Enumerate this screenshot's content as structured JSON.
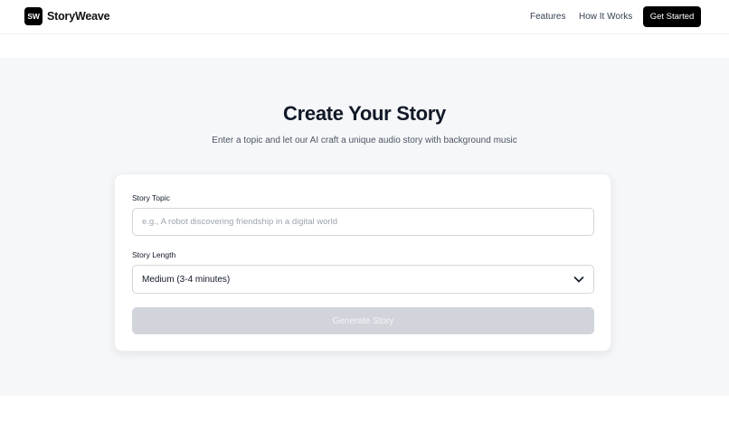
{
  "nav": {
    "logo_mark": "SW",
    "brand": "StoryWeave",
    "links": [
      "Features",
      "How It Works"
    ],
    "cta_label": "Get Started"
  },
  "hero": {
    "title": "Create Your Story",
    "subtitle": "Enter a topic and let our AI craft a unique audio story with background music"
  },
  "form": {
    "topic_label": "Story Topic",
    "topic_value": "",
    "topic_placeholder": "e.g., A robot discovering friendship in a digital world",
    "length_label": "Story Length",
    "length_selected": "Medium (3-4 minutes)",
    "generate_label": "Generate Story",
    "generate_disabled": true
  },
  "icons": {
    "select_arrow": "chevron-down-icon"
  },
  "colors": {
    "brand": "#000000",
    "hero_bg": "#f6f7f9",
    "disabled_button": "#d1d5db"
  }
}
